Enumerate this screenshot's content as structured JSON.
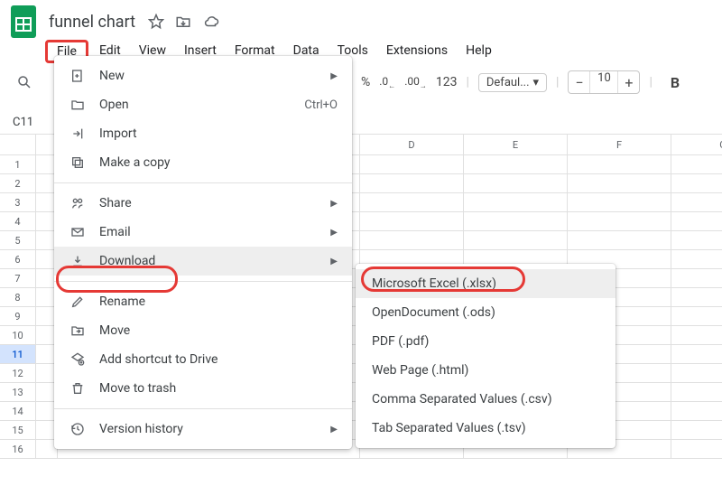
{
  "doc": {
    "title": "funnel chart"
  },
  "menubar": {
    "file": "File",
    "edit": "Edit",
    "view": "View",
    "insert": "Insert",
    "format": "Format",
    "data": "Data",
    "tools": "Tools",
    "extensions": "Extensions",
    "help": "Help"
  },
  "toolbar": {
    "percent": "%",
    "dec_dec": ".0",
    "dec_inc": ".00",
    "num_123": "123",
    "font": "Defaul...",
    "size": "10",
    "minus": "−",
    "plus": "+",
    "bold": "B"
  },
  "cellref": "C11",
  "columns": [
    "",
    "D",
    "E",
    "F",
    "G"
  ],
  "rows": [
    "1",
    "2",
    "3",
    "4",
    "5",
    "6",
    "7",
    "8",
    "9",
    "10",
    "11",
    "12",
    "13",
    "14",
    "15",
    "16"
  ],
  "file_menu": {
    "new": "New",
    "open": "Open",
    "open_sc": "Ctrl+O",
    "import": "Import",
    "make_copy": "Make a copy",
    "share": "Share",
    "email": "Email",
    "download": "Download",
    "rename": "Rename",
    "move": "Move",
    "add_shortcut": "Add shortcut to Drive",
    "move_to_trash": "Move to trash",
    "version_history": "Version history"
  },
  "download_submenu": {
    "xlsx": "Microsoft Excel (.xlsx)",
    "ods": "OpenDocument (.ods)",
    "pdf": "PDF (.pdf)",
    "html": "Web Page (.html)",
    "csv": "Comma Separated Values (.csv)",
    "tsv": "Tab Separated Values (.tsv)"
  },
  "selected_row": "11"
}
